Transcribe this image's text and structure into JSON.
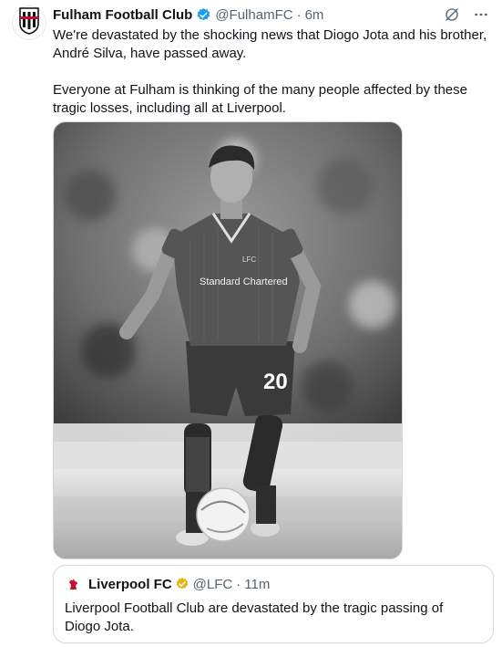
{
  "tweet": {
    "author_name": "Fulham Football Club",
    "author_handle": "@FulhamFC",
    "separator": "·",
    "time": "6m",
    "text_p1": "We're devastated by the shocking news that Diogo Jota and his brother, André Silva, have passed away.",
    "text_p2": "Everyone at Fulham is thinking of the many people affected by these tragic losses, including all at Liverpool.",
    "avatar_icon": "fulham-crest-icon",
    "verified_icon": "verified-badge-icon",
    "verified_color": "#1d9bf0",
    "grok_icon": "grok-icon",
    "more_icon": "more-options-icon"
  },
  "media": {
    "type": "photo",
    "style": "black-and-white",
    "jersey_number": "20",
    "sponsor": "Standard Chartered",
    "kit_badge": "LFC"
  },
  "quote": {
    "author_name": "Liverpool FC",
    "author_handle": "@LFC",
    "separator": "·",
    "time": "11m",
    "text": "Liverpool Football Club are devastated by the tragic passing of Diogo Jota.",
    "avatar_icon": "liverbird-icon",
    "badge_icon": "gold-verified-badge-icon",
    "badge_color": "#e2b719"
  }
}
